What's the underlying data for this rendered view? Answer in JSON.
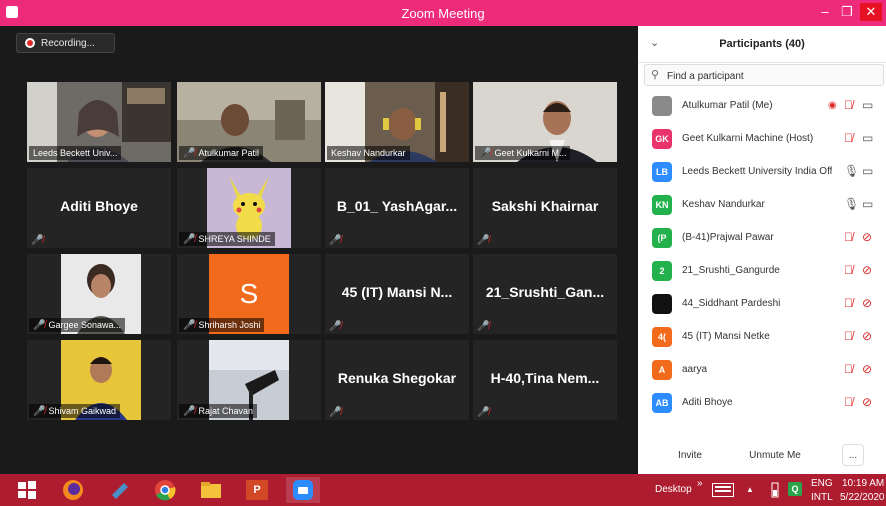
{
  "window": {
    "title": "Zoom Meeting",
    "minimize": "–",
    "restore": "❐",
    "close": "✕"
  },
  "recording": {
    "label": "Recording..."
  },
  "tiles": [
    {
      "label": "Leeds Beckett Univ...",
      "muted": false,
      "active": true
    },
    {
      "label": "Atulkumar Patil",
      "muted": true
    },
    {
      "label": "Keshav Nandurkar",
      "muted": false
    },
    {
      "label": "Geet Kulkarni M...",
      "muted": true
    },
    {
      "big": "Aditi Bhoye",
      "muted": true
    },
    {
      "label": "SHREYA SHINDE",
      "muted": true
    },
    {
      "big": "B_01_ YashAgar...",
      "muted": true
    },
    {
      "big": "Sakshi Khairnar",
      "muted": true
    },
    {
      "label": "Gargee Sonawa...",
      "muted": true
    },
    {
      "label": "Shriharsh Joshi",
      "muted": true,
      "letter": "S"
    },
    {
      "big": "45 (IT) Mansi N...",
      "muted": true
    },
    {
      "big": "21_Srushti_Gan...",
      "muted": true
    },
    {
      "label": "Shivam Gaikwad",
      "muted": true
    },
    {
      "label": "Rajat Chavan",
      "muted": true
    },
    {
      "big": "Renuka Shegokar",
      "muted": true
    },
    {
      "big": "H-40,Tina Nem...",
      "muted": true
    }
  ],
  "participants": {
    "title": "Participants (40)",
    "search_placeholder": "Find a participant",
    "list": [
      {
        "initials": "",
        "name": "Atulkumar Patil (Me)",
        "color": "#8a8a8a",
        "mic": "muted",
        "video": "on",
        "recording": true
      },
      {
        "initials": "GK",
        "name": "Geet Kulkarni Machine (Host)",
        "color": "#e8336b",
        "mic": "muted",
        "video": "on"
      },
      {
        "initials": "LB",
        "name": "Leeds Beckett University India Off...",
        "color": "#2d8cff",
        "mic": "on",
        "video": "on"
      },
      {
        "initials": "KN",
        "name": "Keshav Nandurkar",
        "color": "#22b14c",
        "mic": "on",
        "video": "on"
      },
      {
        "initials": "(P",
        "name": "(B-41)Prajwal Pawar",
        "color": "#22b14c",
        "mic": "muted",
        "video": "off"
      },
      {
        "initials": "2",
        "name": "21_Srushti_Gangurde",
        "color": "#22b14c",
        "mic": "muted",
        "video": "off"
      },
      {
        "initials": "",
        "name": "44_Siddhant Pardeshi",
        "color": "#111111",
        "mic": "muted",
        "video": "off"
      },
      {
        "initials": "4(",
        "name": "45 (IT) Mansi Netke",
        "color": "#f26a1b",
        "mic": "muted",
        "video": "off"
      },
      {
        "initials": "A",
        "name": "aarya",
        "color": "#f26a1b",
        "mic": "muted",
        "video": "off"
      },
      {
        "initials": "AB",
        "name": "Aditi Bhoye",
        "color": "#2d8cff",
        "mic": "muted",
        "video": "off"
      }
    ],
    "invite": "Invite",
    "unmute": "Unmute Me",
    "more": "..."
  },
  "taskbar": {
    "desktop": "Desktop",
    "lang": "ENG",
    "layout": "INTL",
    "time": "10:19 AM",
    "date": "5/22/2020",
    "ppt_label": "P",
    "expand": "»",
    "up": "▲"
  },
  "colors": {
    "title_bar": "#ee2a7b",
    "taskbar": "#ad1c2f",
    "muted": "#e02828",
    "active_speaker": "#c8d84a"
  }
}
